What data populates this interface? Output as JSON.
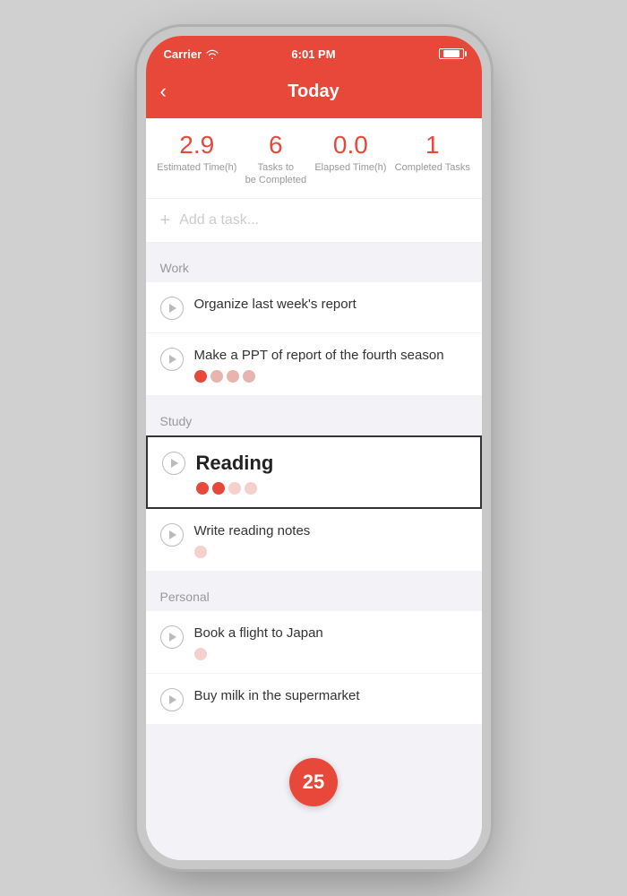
{
  "statusBar": {
    "carrier": "Carrier",
    "time": "6:01 PM",
    "battery": "■■■■"
  },
  "header": {
    "backLabel": "‹",
    "title": "Today"
  },
  "stats": [
    {
      "id": "estimated-time",
      "value": "2.9",
      "label": "Estimated Time(h)"
    },
    {
      "id": "tasks-to-complete",
      "value": "6",
      "label": "Tasks to\nbe Completed"
    },
    {
      "id": "elapsed-time",
      "value": "0.0",
      "label": "Elapsed Time(h)"
    },
    {
      "id": "completed-tasks",
      "value": "1",
      "label": "Completed Tasks"
    }
  ],
  "addTask": {
    "placeholder": "Add a task...",
    "icon": "+"
  },
  "sections": [
    {
      "id": "work",
      "label": "Work",
      "tasks": [
        {
          "id": "task-1",
          "title": "Organize last week's report",
          "tomatoes": [],
          "highlighted": false
        },
        {
          "id": "task-2",
          "title": "Make a PPT of report of the fourth season",
          "tomatoes": [
            "filled",
            "empty",
            "empty",
            "empty"
          ],
          "highlighted": false
        }
      ]
    },
    {
      "id": "study",
      "label": "Study",
      "tasks": [
        {
          "id": "task-3",
          "title": "Reading",
          "tomatoes": [
            "filled",
            "filled",
            "light",
            "light"
          ],
          "highlighted": true,
          "bold": true
        },
        {
          "id": "task-4",
          "title": "Write reading notes",
          "tomatoes": [
            "light"
          ],
          "highlighted": false
        }
      ]
    },
    {
      "id": "personal",
      "label": "Personal",
      "tasks": [
        {
          "id": "task-5",
          "title": "Book a flight to Japan",
          "tomatoes": [
            "light"
          ],
          "highlighted": false
        },
        {
          "id": "task-6",
          "title": "Buy milk in the supermarket",
          "tomatoes": [],
          "highlighted": false
        }
      ]
    }
  ],
  "floatingBadge": {
    "value": "25"
  },
  "colors": {
    "accent": "#e8483a",
    "text": "#333",
    "muted": "#999"
  }
}
